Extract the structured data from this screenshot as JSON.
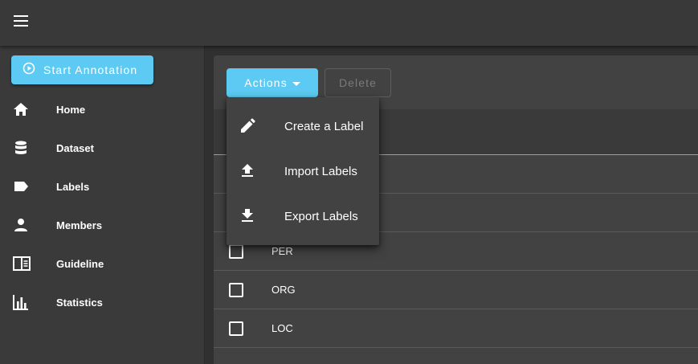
{
  "appbar": {
    "menu_icon": "hamburger-menu-icon"
  },
  "sidebar": {
    "start_button": {
      "label": "Start Annotation",
      "icon": "play-circle-icon"
    },
    "items": [
      {
        "label": "Home",
        "icon": "home-icon"
      },
      {
        "label": "Dataset",
        "icon": "database-icon"
      },
      {
        "label": "Labels",
        "icon": "label-icon"
      },
      {
        "label": "Members",
        "icon": "account-icon"
      },
      {
        "label": "Guideline",
        "icon": "book-open-icon"
      },
      {
        "label": "Statistics",
        "icon": "bar-chart-icon"
      }
    ]
  },
  "toolbar": {
    "actions_label": "Actions",
    "delete_label": "Delete"
  },
  "menu": {
    "items": [
      {
        "label": "Create a Label",
        "icon": "pencil-icon"
      },
      {
        "label": "Import Labels",
        "icon": "upload-icon"
      },
      {
        "label": "Export Labels",
        "icon": "download-icon"
      }
    ]
  },
  "table": {
    "rows": [
      {
        "name": "PER"
      },
      {
        "name": "ORG"
      },
      {
        "name": "LOC"
      }
    ]
  },
  "colors": {
    "accent": "#5ccaf2",
    "appbar": "#393939",
    "surface": "#424242",
    "background": "#303030"
  }
}
